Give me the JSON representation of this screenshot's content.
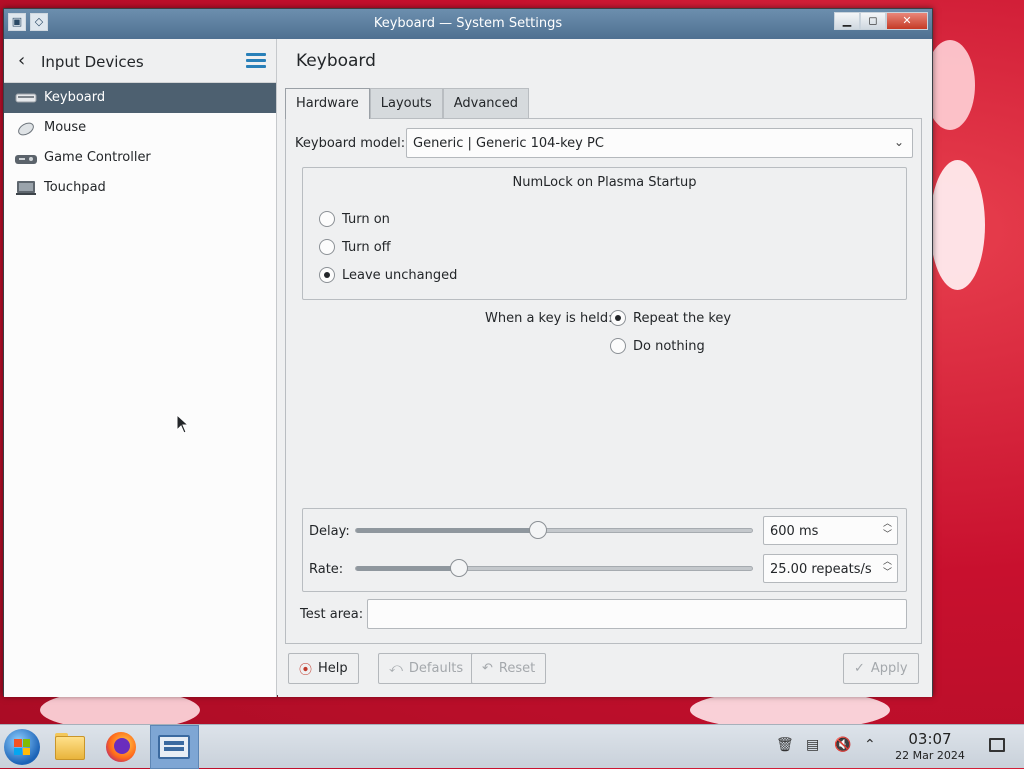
{
  "window": {
    "title": "Keyboard — System Settings",
    "buttons": {
      "minimize": "▁",
      "maximize": "◻",
      "close": "✕"
    }
  },
  "sidebar": {
    "title": "Input Devices",
    "items": [
      {
        "label": "Keyboard",
        "icon": "keyboard-icon",
        "active": true
      },
      {
        "label": "Mouse",
        "icon": "mouse-icon",
        "active": false
      },
      {
        "label": "Game Controller",
        "icon": "gamepad-icon",
        "active": false
      },
      {
        "label": "Touchpad",
        "icon": "touchpad-icon",
        "active": false
      }
    ]
  },
  "main": {
    "title": "Keyboard",
    "tabs": [
      {
        "label": "Hardware",
        "active": true
      },
      {
        "label": "Layouts",
        "active": false
      },
      {
        "label": "Advanced",
        "active": false
      }
    ],
    "keyboard_model": {
      "label": "Keyboard model:",
      "value": "Generic | Generic 104-key PC"
    },
    "numlock": {
      "title": "NumLock on Plasma Startup",
      "options": [
        {
          "label": "Turn on",
          "checked": false
        },
        {
          "label": "Turn off",
          "checked": false
        },
        {
          "label": "Leave unchanged",
          "checked": true
        }
      ]
    },
    "key_held": {
      "label": "When a key is held:",
      "options": [
        {
          "label": "Repeat the key",
          "checked": true
        },
        {
          "label": "Do nothing",
          "checked": false
        }
      ]
    },
    "delay": {
      "label": "Delay:",
      "value": "600 ms",
      "fraction": 0.46
    },
    "rate": {
      "label": "Rate:",
      "value": "25.00 repeats/s",
      "fraction": 0.26
    },
    "test_area": {
      "label": "Test area:",
      "value": ""
    },
    "buttons": {
      "help": "Help",
      "defaults": "Defaults",
      "reset": "Reset",
      "apply": "Apply"
    }
  },
  "taskbar": {
    "clock_time": "03:07",
    "clock_date": "22 Mar 2024"
  },
  "colors": {
    "accent": "#2980b9",
    "selection": "#4d6070",
    "titlebar": "#5f7f9f"
  }
}
